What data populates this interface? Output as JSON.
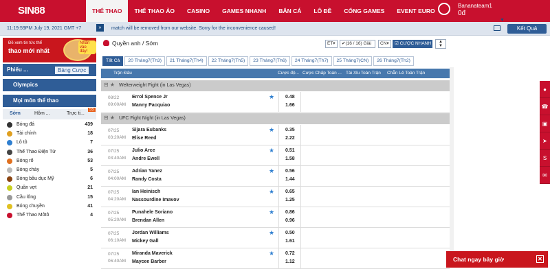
{
  "header": {
    "logo": "SIN88",
    "nav": [
      "THỂ THAO",
      "THỂ THAO ẢO",
      "CASINO",
      "GAMES NHANH",
      "BẮN CÁ",
      "LÔ ĐỀ",
      "CỔNG GAMES",
      "EVENT EURO"
    ],
    "username": "Bananateam1",
    "balance": "0đ"
  },
  "infobar": {
    "time": "11:19:59PM July 19, 2021 GMT +7",
    "marquee": "match will be removed from our website. Sorry for the inconvenience caused!",
    "ketqua": "Kết Quả"
  },
  "sidebar": {
    "promo": {
      "line1": "Đề xem tin tức thể",
      "line2": "thao mới nhất",
      "bubble": "Nhấn vào đây!"
    },
    "tab_a": "Phiếu ...",
    "tab_b": "Bảng Cược",
    "olympics": "Olympics",
    "moimon": "Mọi môn thể thao",
    "subtabs": [
      "Sớm",
      "Hôm ...",
      "Trực ti..."
    ],
    "live_badge": "55",
    "sports": [
      {
        "name": "Bóng đá",
        "count": "439",
        "color": "#333"
      },
      {
        "name": "Tài chính",
        "count": "18",
        "color": "#e0a020"
      },
      {
        "name": "Lô tô",
        "count": "7",
        "color": "#2f7fd0"
      },
      {
        "name": "Thể Thao Điện Tử",
        "count": "36",
        "color": "#444"
      },
      {
        "name": "Bóng rổ",
        "count": "53",
        "color": "#e07020"
      },
      {
        "name": "Bóng chày",
        "count": "5",
        "color": "#bbb"
      },
      {
        "name": "Bóng bầu dục Mỹ",
        "count": "6",
        "color": "#8b4513"
      },
      {
        "name": "Quần vợt",
        "count": "21",
        "color": "#c8d020"
      },
      {
        "name": "Cầu lông",
        "count": "15",
        "color": "#999"
      },
      {
        "name": "Bóng chuyền",
        "count": "41",
        "color": "#e0c020"
      },
      {
        "name": "Thể Thao Môtô",
        "count": "4",
        "color": "#c8102e"
      }
    ]
  },
  "main": {
    "heading": "Quyền anh / Sớm",
    "controls": {
      "filter": "ET▾",
      "count": "(16 / 16) Giải",
      "cn": "CN▾",
      "nhanh": "CƯỢC NHANH"
    },
    "date_tabs": [
      "Tất Cả",
      "20 Tháng7(Th3)",
      "21 Tháng7(Th4)",
      "22 Tháng7(Th5)",
      "23 Tháng7(Th6)",
      "24 Tháng7(Th7)",
      "25 Tháng7(CN)",
      "26 Tháng7(Th2)"
    ],
    "columns": [
      "Trận Đấu",
      "Cược độ...",
      "Cược Chấp Toàn ...",
      "Tài Xỉu Toàn Trận",
      "Chẵn Lẻ Toàn Trận"
    ],
    "leagues": [
      {
        "name": "Welterweight Fight (in Las Vegas)",
        "matches": [
          {
            "date": "08/22",
            "time": "09:00AM",
            "t1": "Errol Spence Jr",
            "t2": "Manny Pacquiao",
            "o1": "0.48",
            "o2": "1.66"
          }
        ]
      },
      {
        "name": "UFC Fight Night (in Las Vegas)",
        "matches": [
          {
            "date": "07/25",
            "time": "03:20AM",
            "t1": "Sijara Eubanks",
            "t2": "Elise Reed",
            "o1": "0.35",
            "o2": "2.22"
          },
          {
            "date": "07/25",
            "time": "03:40AM",
            "t1": "Julio Arce",
            "t2": "Andre Ewell",
            "o1": "0.51",
            "o2": "1.58"
          },
          {
            "date": "07/25",
            "time": "04:00AM",
            "t1": "Adrian Yanez",
            "t2": "Randy Costa",
            "o1": "0.56",
            "o2": "1.44"
          },
          {
            "date": "07/25",
            "time": "04:20AM",
            "t1": "Ian Heinisch",
            "t2": "Nassourdine Imavov",
            "o1": "0.65",
            "o2": "1.25"
          },
          {
            "date": "07/25",
            "time": "05:20AM",
            "t1": "Punahele Soriano",
            "t2": "Brendan Allen",
            "o1": "0.86",
            "o2": "0.96"
          },
          {
            "date": "07/25",
            "time": "06:10AM",
            "t1": "Jordan Williams",
            "t2": "Mickey Gall",
            "o1": "0.50",
            "o2": "1.61"
          },
          {
            "date": "07/25",
            "time": "06:40AM",
            "t1": "Miranda Maverick",
            "t2": "Maycee Barber",
            "o1": "0.72",
            "o2": "1.12"
          }
        ]
      }
    ]
  },
  "chat": "Chat ngay bây giờ"
}
